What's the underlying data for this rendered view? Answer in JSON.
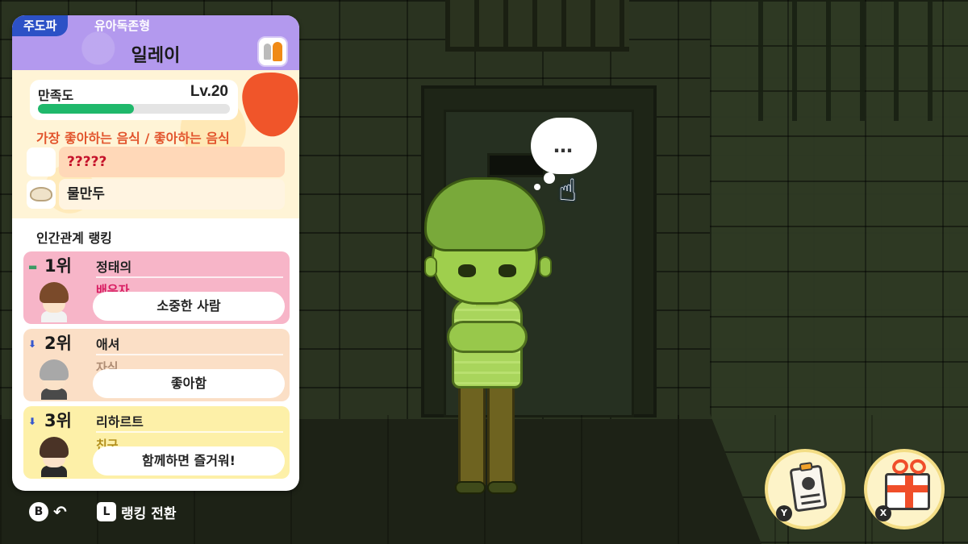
{
  "panel": {
    "tags": {
      "main": "주도파",
      "sub": "유아독존형"
    },
    "name": "일레이",
    "satisfaction": {
      "label": "만족도",
      "level": "Lv.20",
      "progress": 0.5
    },
    "food": {
      "heading": "가장 좋아하는 음식 / 좋아하는 음식",
      "favorite": "?????",
      "liked": "물만두"
    },
    "ranking": {
      "heading": "인간관계 랭킹",
      "entries": [
        {
          "rank": "1위",
          "trend": "same",
          "name": "정태의",
          "relation": "배우자",
          "comment": "소중한 사람"
        },
        {
          "rank": "2위",
          "trend": "down",
          "name": "애셔",
          "relation": "자식",
          "comment": "좋아함"
        },
        {
          "rank": "3위",
          "trend": "down",
          "name": "리하르트",
          "relation": "친구",
          "comment": "함께하면 즐거워!"
        }
      ]
    }
  },
  "speech_bubble": "…",
  "controls": {
    "back_key": "B",
    "switch_key": "L",
    "switch_label": "랭킹 전환"
  },
  "actions": {
    "profile_key": "Y",
    "gift_key": "X"
  },
  "colors": {
    "header": "#b399ee",
    "main_tag": "#2c51c6",
    "satisfaction_fill": "#1fb86b",
    "rank1": "#f7b5c8",
    "rank2": "#fbdfc6",
    "rank3": "#fdf0a8"
  }
}
